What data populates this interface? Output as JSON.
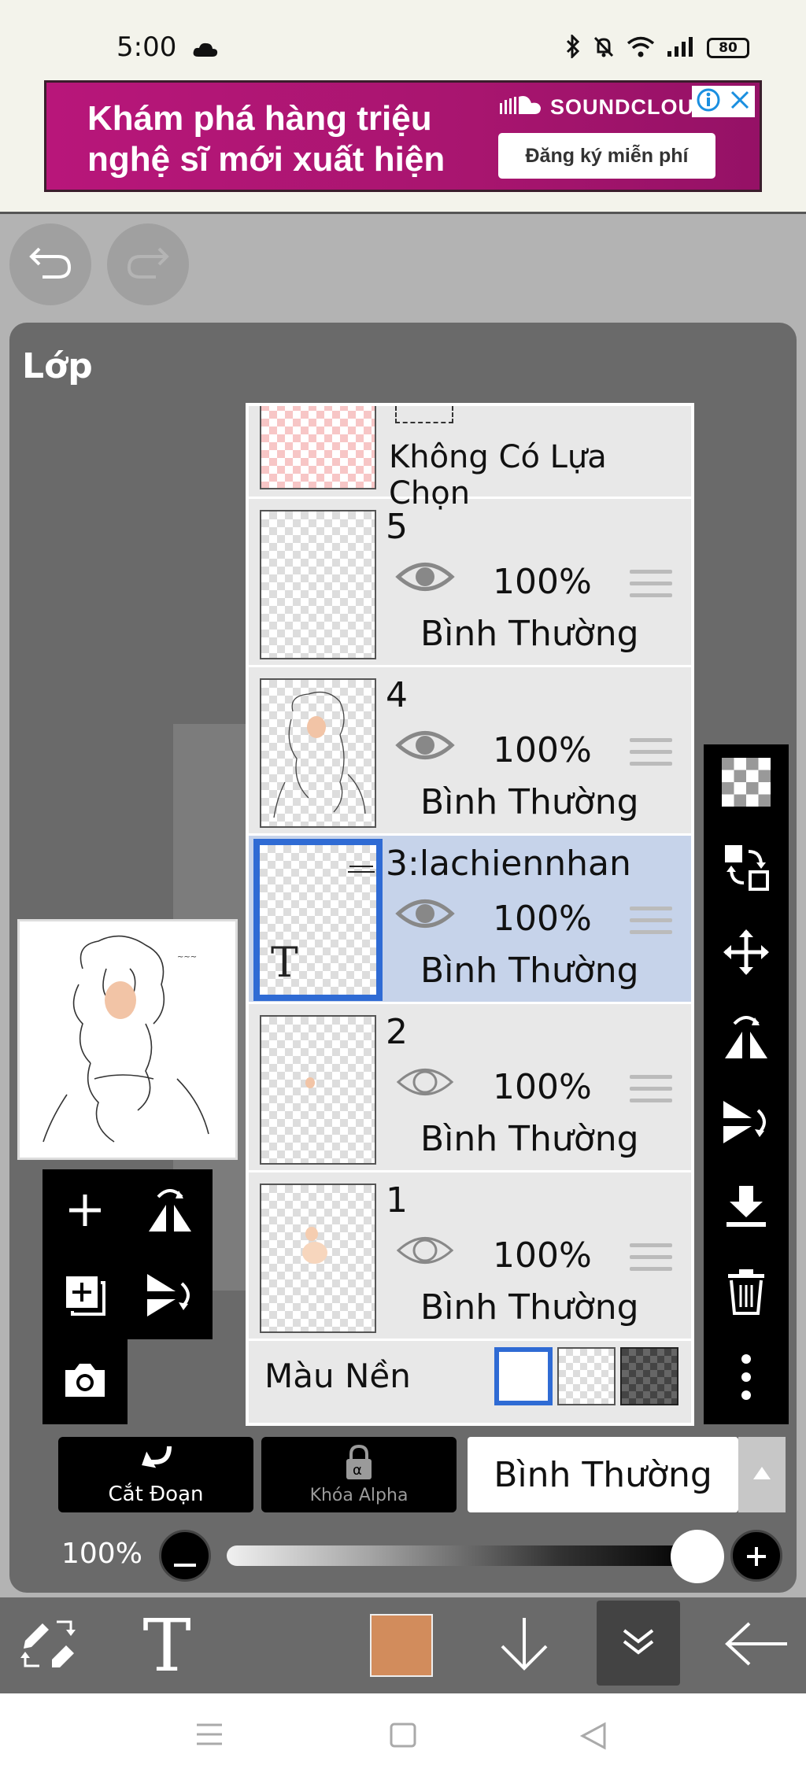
{
  "status_bar": {
    "time": "5:00",
    "battery": "80"
  },
  "ad": {
    "headline_line1": "Khám phá hàng triệu",
    "headline_line2": "nghệ sĩ mới xuất hiện",
    "brand": "SOUNDCLOU",
    "cta": "Đăng ký miễn phí"
  },
  "panel": {
    "title": "Lớp"
  },
  "selection_layer": {
    "label": "Không Có Lựa Chọn"
  },
  "layers": [
    {
      "name": "5",
      "opacity": "100%",
      "blend": "Bình Thường",
      "visible": true,
      "selected": false
    },
    {
      "name": "4",
      "opacity": "100%",
      "blend": "Bình Thường",
      "visible": true,
      "selected": false
    },
    {
      "name": "3:lachiennhan",
      "opacity": "100%",
      "blend": "Bình Thường",
      "visible": true,
      "selected": true,
      "text_layer": true
    },
    {
      "name": "2",
      "opacity": "100%",
      "blend": "Bình Thường",
      "visible": false,
      "selected": false
    },
    {
      "name": "1",
      "opacity": "100%",
      "blend": "Bình Thường",
      "visible": false,
      "selected": false
    }
  ],
  "background": {
    "label": "Màu Nền",
    "selected": "white"
  },
  "controls": {
    "clip_label": "Cắt Đoạn",
    "alpha_lock_label": "Khóa Alpha",
    "blend_mode": "Bình Thường",
    "opacity_label": "100%",
    "opacity_value": 1.0
  },
  "text_tool_glyph": "T",
  "current_color": "#d28c5c",
  "accent_color": "#2f6bd4"
}
